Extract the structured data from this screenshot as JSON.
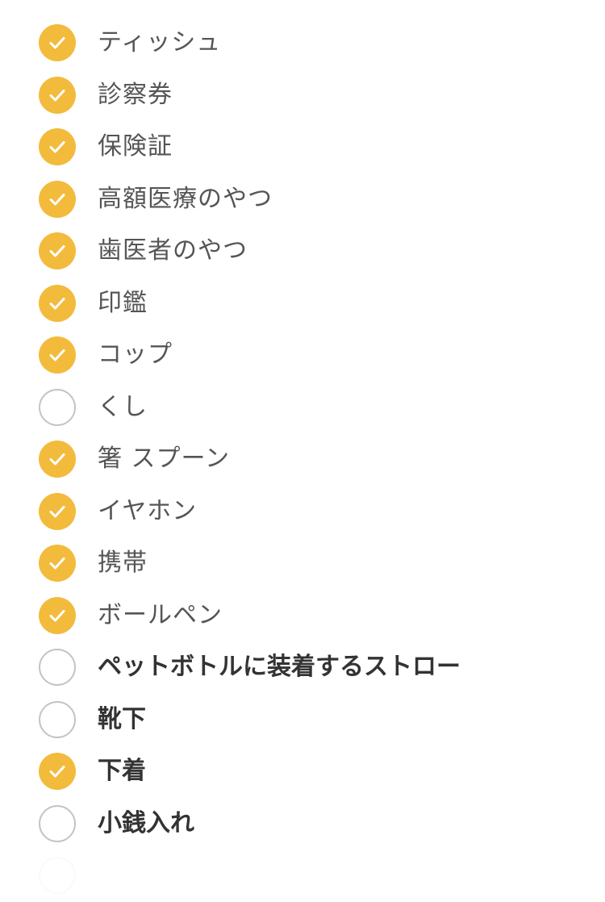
{
  "checklist": {
    "items": [
      {
        "label": "ティッシュ",
        "checked": true,
        "bold": false
      },
      {
        "label": "診察券",
        "checked": true,
        "bold": false
      },
      {
        "label": "保険証",
        "checked": true,
        "bold": false
      },
      {
        "label": "高額医療のやつ",
        "checked": true,
        "bold": false
      },
      {
        "label": "歯医者のやつ",
        "checked": true,
        "bold": false
      },
      {
        "label": "印鑑",
        "checked": true,
        "bold": false
      },
      {
        "label": "コップ",
        "checked": true,
        "bold": false
      },
      {
        "label": "くし",
        "checked": false,
        "bold": false
      },
      {
        "label": "箸 スプーン",
        "checked": true,
        "bold": false
      },
      {
        "label": "イヤホン",
        "checked": true,
        "bold": false
      },
      {
        "label": "携帯",
        "checked": true,
        "bold": false
      },
      {
        "label": "ボールペン",
        "checked": true,
        "bold": false
      },
      {
        "label": "ペットボトルに装着するストロー",
        "checked": false,
        "bold": true
      },
      {
        "label": "靴下",
        "checked": false,
        "bold": true
      },
      {
        "label": "下着",
        "checked": true,
        "bold": true
      },
      {
        "label": "小銭入れ",
        "checked": false,
        "bold": true
      }
    ]
  },
  "colors": {
    "checked_fill": "#f2bb3c",
    "unchecked_border": "#c4c4c4",
    "checkmark": "#ffffff",
    "text": "#555555",
    "text_bold": "#333333"
  },
  "icons": {
    "checked": "check-circle-filled-icon",
    "unchecked": "circle-outline-icon"
  }
}
